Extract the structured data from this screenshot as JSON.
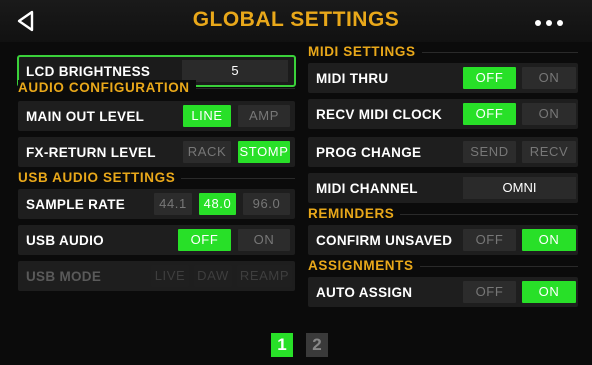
{
  "header": {
    "title": "GLOBAL SETTINGS",
    "back_icon": "back-triangle-icon",
    "more_icon": "more-dots-icon",
    "accent_color": "#e9a81a"
  },
  "left": {
    "lcd_brightness": {
      "label": "LCD BRIGHTNESS",
      "value": "5"
    },
    "audio_configuration": {
      "title": "AUDIO CONFIGURATION",
      "main_out_level": {
        "label": "MAIN OUT LEVEL",
        "options": [
          "LINE",
          "AMP"
        ],
        "selected": "LINE"
      },
      "fx_return_level": {
        "label": "FX-RETURN LEVEL",
        "options": [
          "RACK",
          "STOMP"
        ],
        "selected": "STOMP"
      }
    },
    "usb_audio_settings": {
      "title": "USB AUDIO SETTINGS",
      "sample_rate": {
        "label": "SAMPLE RATE",
        "options": [
          "44.1",
          "48.0",
          "96.0"
        ],
        "selected": "48.0"
      },
      "usb_audio": {
        "label": "USB AUDIO",
        "options": [
          "OFF",
          "ON"
        ],
        "selected": "OFF"
      },
      "usb_mode": {
        "label": "USB MODE",
        "options": [
          "LIVE",
          "DAW",
          "REAMP"
        ],
        "selected": null,
        "disabled": true
      }
    }
  },
  "right": {
    "midi_settings": {
      "title": "MIDI SETTINGS",
      "midi_thru": {
        "label": "MIDI THRU",
        "options": [
          "OFF",
          "ON"
        ],
        "selected": "OFF"
      },
      "recv_midi_clock": {
        "label": "RECV MIDI CLOCK",
        "options": [
          "OFF",
          "ON"
        ],
        "selected": "OFF"
      },
      "prog_change": {
        "label": "PROG CHANGE",
        "options": [
          "SEND",
          "RECV"
        ],
        "selected": null
      },
      "midi_channel": {
        "label": "MIDI CHANNEL",
        "value": "OMNI"
      }
    },
    "reminders": {
      "title": "REMINDERS",
      "confirm_unsaved": {
        "label": "CONFIRM UNSAVED",
        "options": [
          "OFF",
          "ON"
        ],
        "selected": "ON"
      }
    },
    "assignments": {
      "title": "ASSIGNMENTS",
      "auto_assign": {
        "label": "AUTO ASSIGN",
        "options": [
          "OFF",
          "ON"
        ],
        "selected": "ON"
      }
    }
  },
  "pager": {
    "page1": "1",
    "page2": "2",
    "current": "1",
    "active_color": "#28e028"
  }
}
